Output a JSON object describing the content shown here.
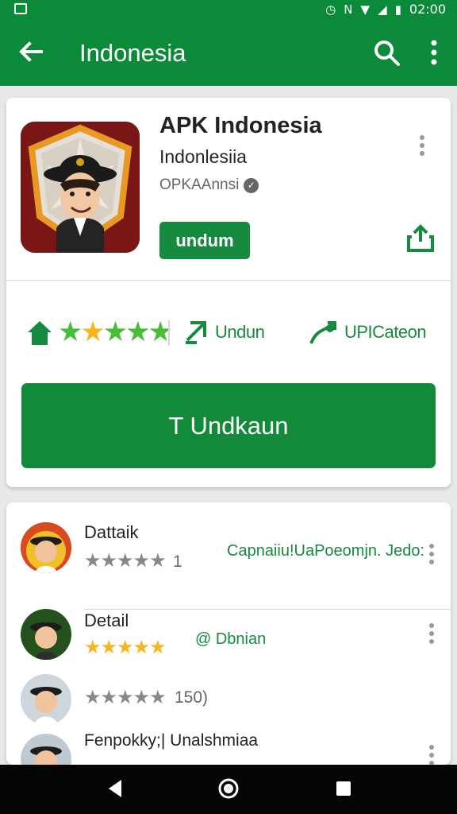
{
  "status": {
    "time": "02:00"
  },
  "appbar": {
    "title": "Indonesia"
  },
  "app": {
    "name": "APK Indonesia",
    "developer": "Indonlesiia",
    "package": "OPKAAnnsi",
    "download_label": "undum"
  },
  "stats": {
    "download_label": "Undun",
    "update_label": "UPICateon"
  },
  "install_button": {
    "label": "T Undkaun"
  },
  "list": [
    {
      "name": "Dattaik",
      "stars": "★★★★★",
      "count": "1",
      "link": "Capnaiiu!UaPoeomjn. Jedo:"
    },
    {
      "name": "Detail",
      "stars": "★★★★★",
      "count": "",
      "link": "@ Dbnian"
    },
    {
      "name": "",
      "stars": "★★★★★",
      "count": "150)",
      "link": ""
    },
    {
      "name": "Fenpokky;| Unalshmiaa",
      "stars": "",
      "count": "",
      "link": ""
    }
  ],
  "colors": {
    "primary": "#0b8a3a",
    "accent": "#168a3f",
    "star": "#42b63a",
    "gold": "#f5b51e",
    "gray": "#888888"
  }
}
